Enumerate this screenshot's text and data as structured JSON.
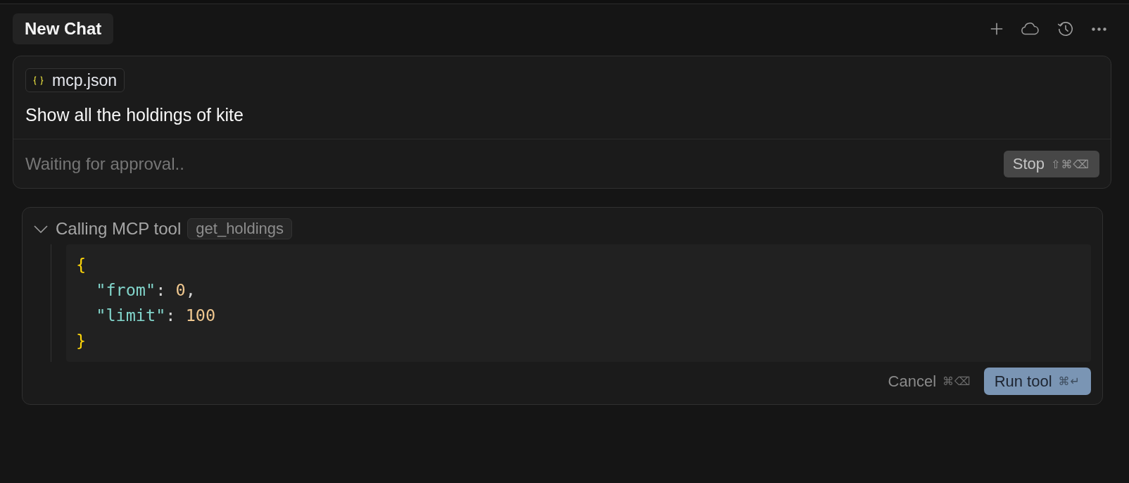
{
  "header": {
    "tab": {
      "label": "New Chat",
      "selected": true
    }
  },
  "composer": {
    "attachment": {
      "label": "mcp.json"
    },
    "message": "Show all the holdings of kite",
    "status": "Waiting for approval..",
    "stop_button": {
      "label": "Stop",
      "shortcut": "⇧⌘⌫"
    }
  },
  "tool_call": {
    "title": "Calling MCP tool",
    "tool_name": "get_holdings",
    "expanded": true,
    "arguments": {
      "open": "{",
      "entries": [
        {
          "key": "\"from\"",
          "separator": ":",
          "value": "0",
          "terminator": ","
        },
        {
          "key": "\"limit\"",
          "separator": ":",
          "value": "100"
        }
      ],
      "close": "}"
    },
    "buttons": [
      {
        "kind": "secondary",
        "label": "Cancel",
        "shortcut": "⌘⌫"
      },
      {
        "kind": "primary",
        "label": "Run tool",
        "shortcut": "⌘↵"
      }
    ]
  }
}
